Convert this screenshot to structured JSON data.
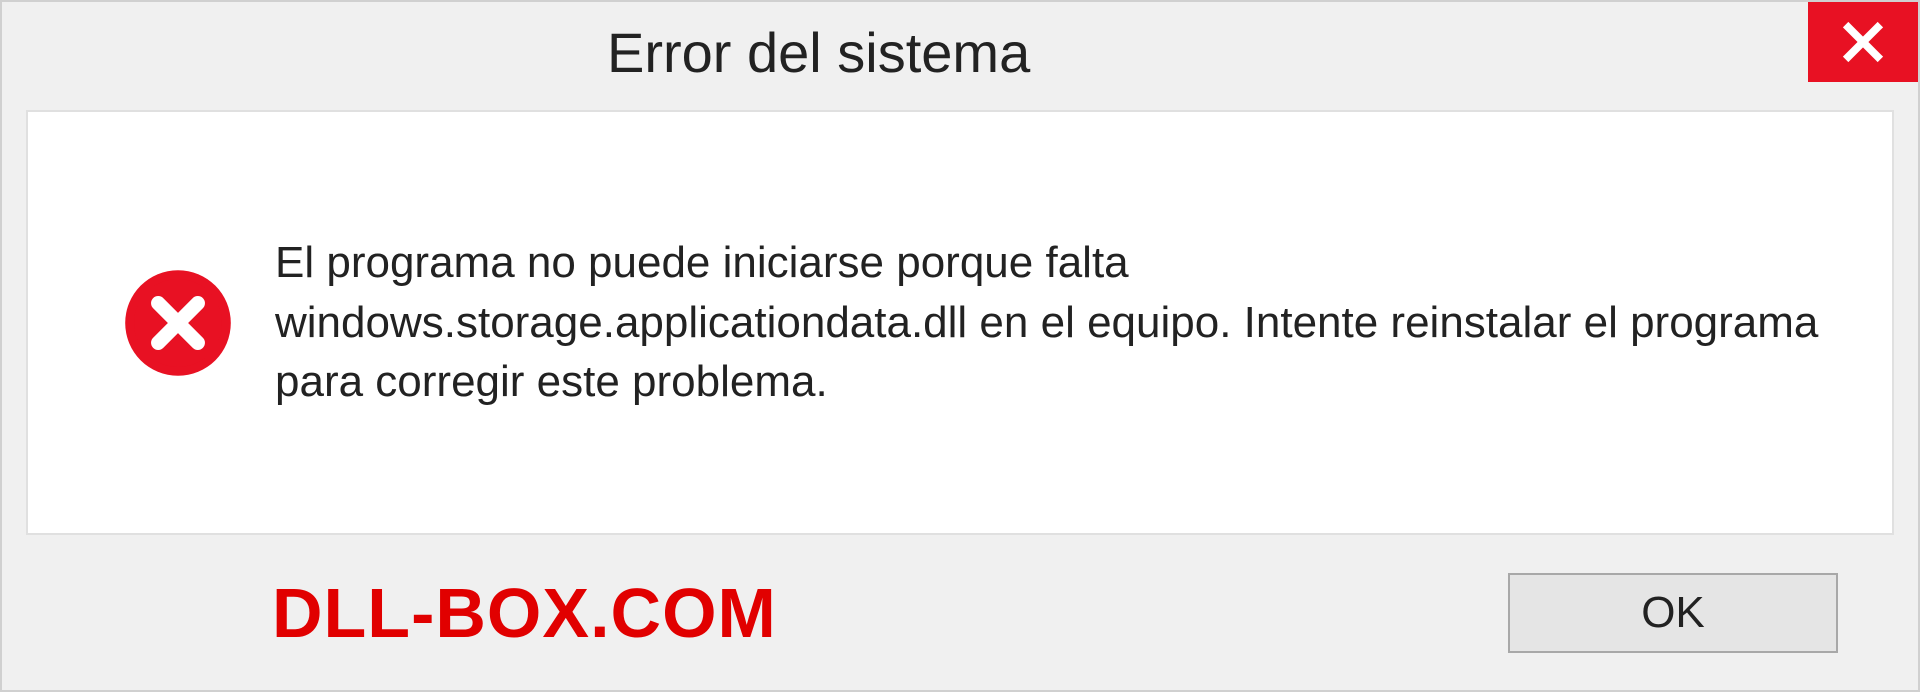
{
  "dialog": {
    "title": "Error del sistema",
    "message": "El programa no puede iniciarse porque falta windows.storage.applicationdata.dll en el equipo. Intente reinstalar el programa para corregir este problema.",
    "ok_label": "OK"
  },
  "watermark": "DLL-BOX.COM",
  "colors": {
    "close_bg": "#e81123",
    "error_red": "#e10000"
  }
}
